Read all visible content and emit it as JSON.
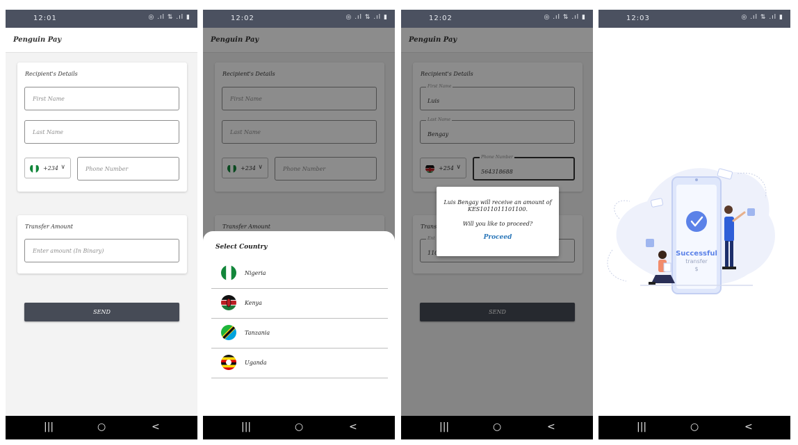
{
  "screens": [
    {
      "status_time": "12:01",
      "status_icons": "◎ .ıl ⇅ .ıl ▮",
      "app_title": "Penguin Pay",
      "recipient_title": "Recipient's Details",
      "first_name_placeholder": "First Name",
      "last_name_placeholder": "Last Name",
      "country_code": "+234",
      "phone_placeholder": "Phone Number",
      "amount_title": "Transfer Amount",
      "amount_placeholder": "Enter amount (In Binary)",
      "send_label": "SEND"
    },
    {
      "status_time": "12:02",
      "status_icons": "◎ .ıl ⇅ .ıl ▮",
      "app_title": "Penguin Pay",
      "recipient_title": "Recipient's Details",
      "first_name_placeholder": "First Name",
      "last_name_placeholder": "Last Name",
      "country_code": "+234",
      "phone_placeholder": "Phone Number",
      "amount_title": "Transfer Amount",
      "sheet_title": "Select Country",
      "countries": [
        "Nigeria",
        "Kenya",
        "Tanzania",
        "Uganda"
      ]
    },
    {
      "status_time": "12:02",
      "status_icons": "◎ .ıl ⇅ .ıl ▮",
      "app_title": "Penguin Pay",
      "recipient_title": "Recipient's Details",
      "first_name_label": "First Name",
      "first_name_value": "Luis",
      "last_name_label": "Last Name",
      "last_name_value": "Bengay",
      "country_code": "+254",
      "phone_label": "Phone Number",
      "phone_value": "564318688",
      "amount_title": "Transf",
      "amount_label": "Ent",
      "amount_value": "110",
      "send_label": "SEND",
      "dialog_message": "Luis Bengay will receive an amount of KES1011011101100.",
      "dialog_question": "Will you like to proceed?",
      "dialog_action": "Proceed"
    },
    {
      "status_time": "12:03",
      "status_icons": "◎ .ıl ⇅ .ıl ▮",
      "success_title": "Successful",
      "success_subtitle": "transfer",
      "success_symbol": "$"
    }
  ],
  "nav": {
    "recents": "|||",
    "home": "○",
    "back": "<"
  },
  "colors": {
    "primary": "#464b56",
    "accent": "#2b77b9",
    "status_bar": "#4b5160",
    "success_blue": "#5b82e8"
  }
}
